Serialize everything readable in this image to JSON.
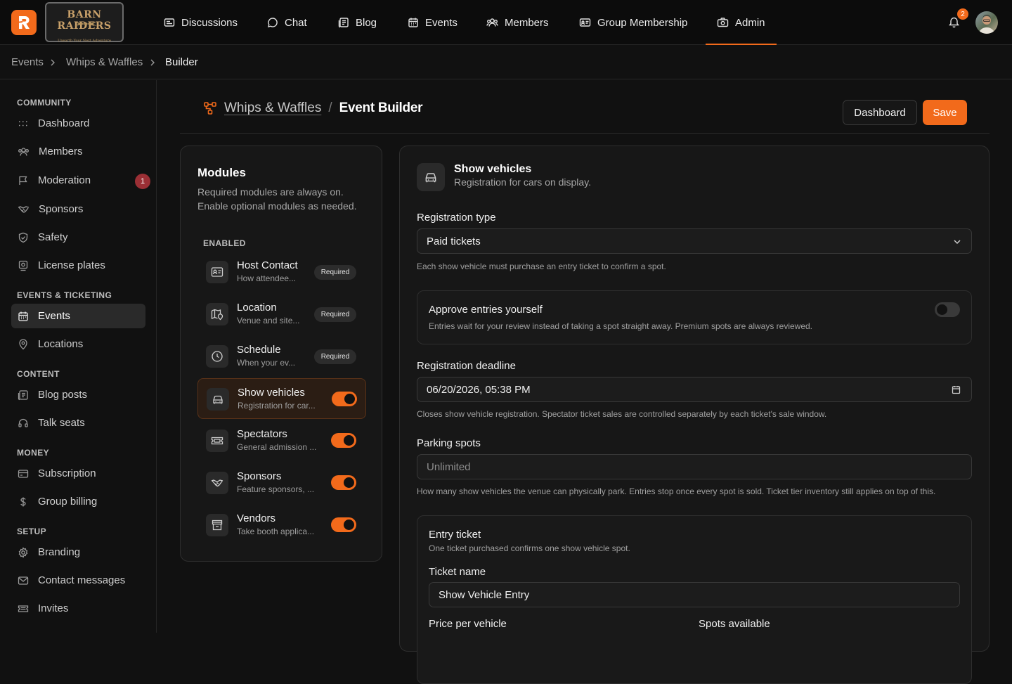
{
  "brand": {
    "name": "BARN RAIDERS",
    "tagline": "Unearth Your Next Adventure",
    "logo_letter": "R",
    "accent": "#f26a1b"
  },
  "nav": {
    "items": [
      {
        "label": "Discussions",
        "icon": "newspaper-icon"
      },
      {
        "label": "Chat",
        "icon": "chat-bubble-icon"
      },
      {
        "label": "Blog",
        "icon": "document-list-icon"
      },
      {
        "label": "Events",
        "icon": "calendar-icon"
      },
      {
        "label": "Members",
        "icon": "people-icon"
      },
      {
        "label": "Group Membership",
        "icon": "id-card-icon"
      },
      {
        "label": "Admin",
        "icon": "camera-icon",
        "active": true
      }
    ],
    "notifications": "2"
  },
  "breadcrumb": [
    "Events",
    "Whips & Waffles",
    "Builder"
  ],
  "sidebar": {
    "sections": [
      "COMMUNITY",
      "EVENTS & TICKETING",
      "CONTENT",
      "MONEY",
      "SETUP"
    ],
    "items": [
      {
        "label": "Dashboard",
        "icon": "grid-dots-icon"
      },
      {
        "label": "Members",
        "icon": "people-icon"
      },
      {
        "label": "Moderation",
        "icon": "flag-icon",
        "badge": "1"
      },
      {
        "label": "Sponsors",
        "icon": "handshake-icon"
      },
      {
        "label": "Safety",
        "icon": "shield-check-icon"
      },
      {
        "label": "License plates",
        "icon": "license-plate-icon"
      },
      {
        "label": "Events",
        "icon": "calendar-icon",
        "active": true
      },
      {
        "label": "Locations",
        "icon": "map-pin-icon"
      },
      {
        "label": "Blog posts",
        "icon": "document-list-icon"
      },
      {
        "label": "Talk seats",
        "icon": "headset-icon"
      },
      {
        "label": "Subscription",
        "icon": "credit-card-icon"
      },
      {
        "label": "Group billing",
        "icon": "dollar-icon"
      },
      {
        "label": "Branding",
        "icon": "gear-icon"
      },
      {
        "label": "Contact messages",
        "icon": "envelope-icon"
      },
      {
        "label": "Invites",
        "icon": "ticket-icon"
      }
    ]
  },
  "page": {
    "parent": "Whips & Waffles",
    "separator": "/",
    "title": "Event Builder",
    "dashboard_button": "Dashboard",
    "save_button": "Save"
  },
  "modules": {
    "title": "Modules",
    "description": "Required modules are always on. Enable optional modules as needed.",
    "enabled_label": "ENABLED",
    "required_label": "Required",
    "items": [
      {
        "name": "Host Contact",
        "sub": "How attendee...",
        "required": true,
        "icon": "contact-card-icon"
      },
      {
        "name": "Location",
        "sub": "Venue and site...",
        "required": true,
        "icon": "map-pin-icon"
      },
      {
        "name": "Schedule",
        "sub": "When your ev...",
        "required": true,
        "icon": "clock-icon"
      },
      {
        "name": "Show vehicles",
        "sub": "Registration for car...",
        "enabled": true,
        "selected": true,
        "icon": "car-icon"
      },
      {
        "name": "Spectators",
        "sub": "General admission ...",
        "enabled": true,
        "icon": "ticket-icon"
      },
      {
        "name": "Sponsors",
        "sub": "Feature sponsors, ...",
        "enabled": true,
        "icon": "handshake-icon"
      },
      {
        "name": "Vendors",
        "sub": "Take booth applica...",
        "enabled": true,
        "icon": "storefront-icon"
      }
    ]
  },
  "detail": {
    "title": "Show vehicles",
    "subtitle": "Registration for cars on display.",
    "registration_type": {
      "label": "Registration type",
      "value": "Paid tickets",
      "hint": "Each show vehicle must purchase an entry ticket to confirm a spot."
    },
    "approve": {
      "title": "Approve entries yourself",
      "desc": "Entries wait for your review instead of taking a spot straight away. Premium spots are always reviewed.",
      "enabled": false
    },
    "deadline": {
      "label": "Registration deadline",
      "value": "06/20/2026, 05:38 PM",
      "hint": "Closes show vehicle registration. Spectator ticket sales are controlled separately by each ticket's sale window."
    },
    "parking": {
      "label": "Parking spots",
      "placeholder": "Unlimited",
      "hint": "How many show vehicles the venue can physically park. Entries stop once every spot is sold. Ticket tier inventory still applies on top of this."
    },
    "entry_ticket": {
      "title": "Entry ticket",
      "desc": "One ticket purchased confirms one show vehicle spot.",
      "name_label": "Ticket name",
      "name_value": "Show Vehicle Entry",
      "price_label": "Price per vehicle",
      "spots_label": "Spots available"
    }
  }
}
